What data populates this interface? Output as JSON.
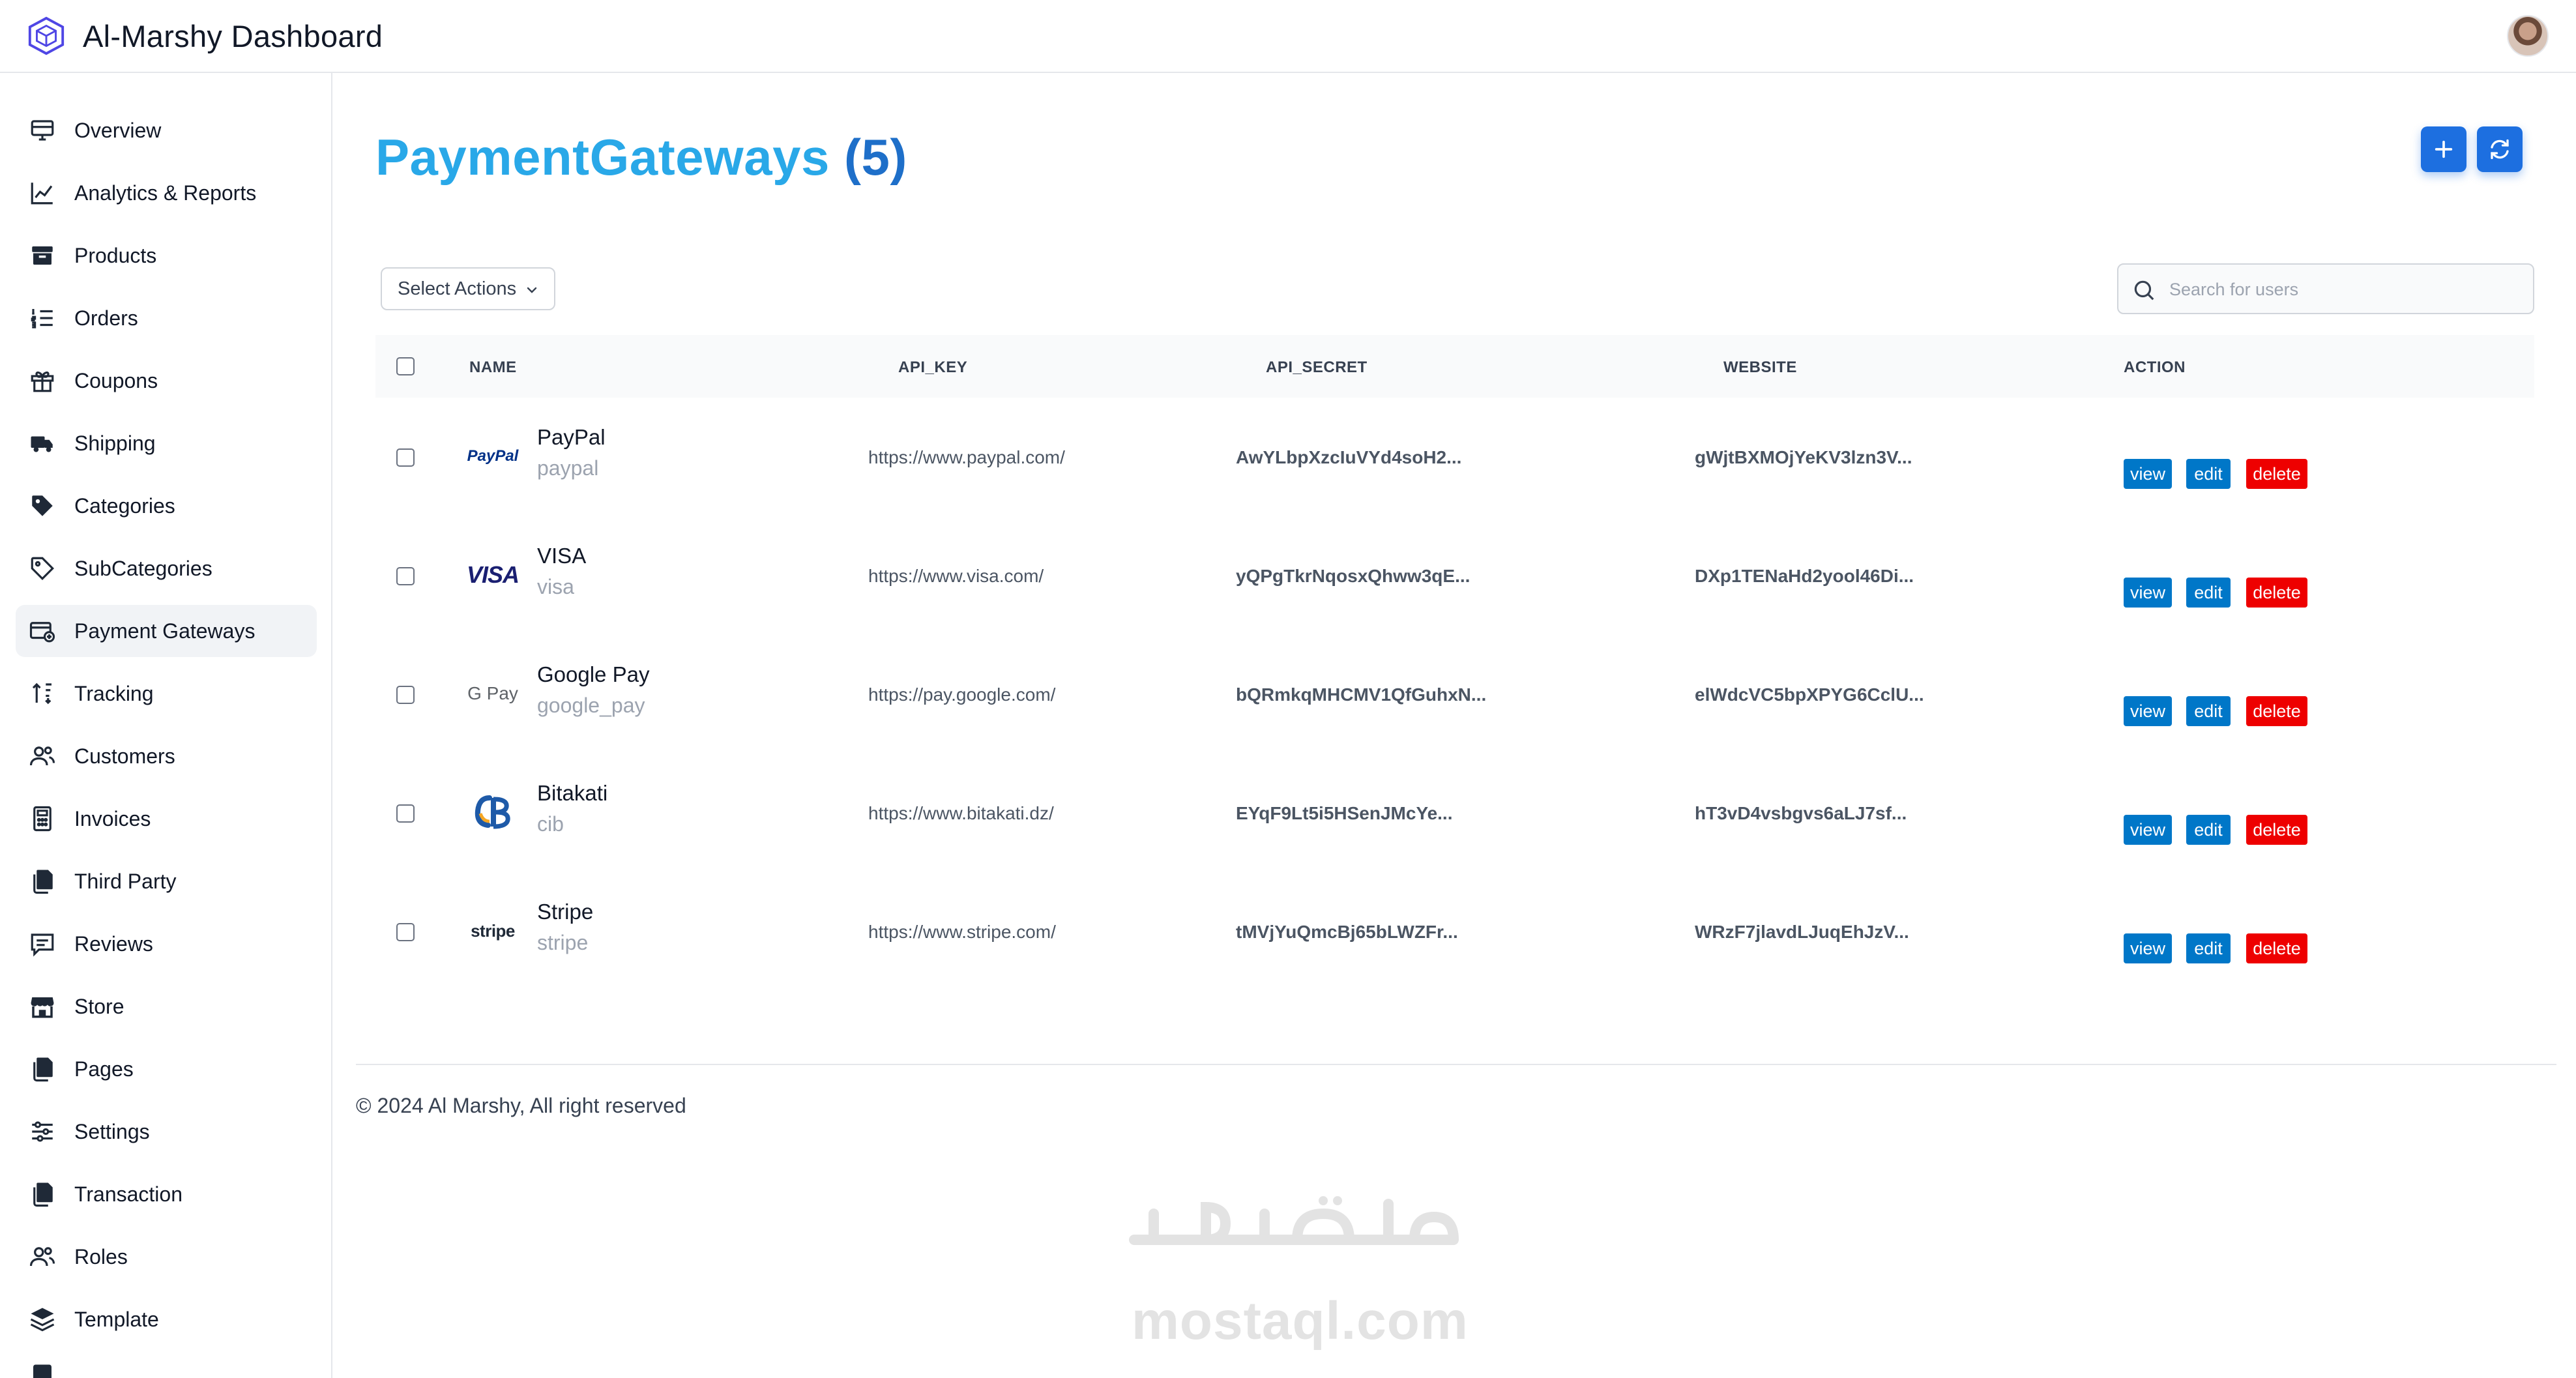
{
  "header": {
    "title": "Al-Marshy Dashboard",
    "logo_icon": "cube-icon",
    "avatar_icon": "user-avatar"
  },
  "sidebar": {
    "items": [
      {
        "label": "Overview",
        "icon": "monitor-icon"
      },
      {
        "label": "Analytics & Reports",
        "icon": "chart-line-icon"
      },
      {
        "label": "Products",
        "icon": "archive-box-icon"
      },
      {
        "label": "Orders",
        "icon": "list-ordered-icon"
      },
      {
        "label": "Coupons",
        "icon": "gift-icon"
      },
      {
        "label": "Shipping",
        "icon": "truck-icon"
      },
      {
        "label": "Categories",
        "icon": "tag-filled-icon"
      },
      {
        "label": "SubCategories",
        "icon": "tag-outline-icon"
      },
      {
        "label": "Payment Gateways",
        "icon": "payment-card-icon",
        "active": true
      },
      {
        "label": "Tracking",
        "icon": "sort-arrows-icon"
      },
      {
        "label": "Customers",
        "icon": "users-icon"
      },
      {
        "label": "Invoices",
        "icon": "calculator-icon"
      },
      {
        "label": "Third Party",
        "icon": "copy-icon"
      },
      {
        "label": "Reviews",
        "icon": "message-icon"
      },
      {
        "label": "Store",
        "icon": "store-icon"
      },
      {
        "label": "Pages",
        "icon": "pages-icon"
      },
      {
        "label": "Settings",
        "icon": "sliders-icon"
      },
      {
        "label": "Transaction",
        "icon": "transaction-icon"
      },
      {
        "label": "Roles",
        "icon": "roles-icon"
      },
      {
        "label": "Template",
        "icon": "layers-icon"
      }
    ]
  },
  "main": {
    "title": "PaymentGateways",
    "count": "(5)",
    "add_button_icon": "plus-icon",
    "refresh_button_icon": "refresh-icon",
    "select_actions_label": "Select Actions",
    "search_placeholder": "Search for users"
  },
  "table": {
    "columns": [
      "NAME",
      "API_KEY",
      "API_SECRET",
      "WEBSITE",
      "ACTION"
    ],
    "rows": [
      {
        "name": "PayPal",
        "code": "paypal",
        "api_key": "https://www.paypal.com/",
        "api_secret": "AwYLbpXzcIuVYd4soH2...",
        "website": "gWjtBXMOjYeKV3lzn3V...",
        "logo": "paypal-logo"
      },
      {
        "name": "VISA",
        "code": "visa",
        "api_key": "https://www.visa.com/",
        "api_secret": "yQPgTkrNqosxQhww3qE...",
        "website": "DXp1TENaHd2yool46Di...",
        "logo": "visa-logo"
      },
      {
        "name": "Google Pay",
        "code": "google_pay",
        "api_key": "https://pay.google.com/",
        "api_secret": "bQRmkqMHCMV1QfGuhxN...",
        "website": "elWdcVC5bpXPYG6CclU...",
        "logo": "google-pay-logo"
      },
      {
        "name": "Bitakati",
        "code": "cib",
        "api_key": "https://www.bitakati.dz/",
        "api_secret": "EYqF9Lt5i5HSenJMcYe...",
        "website": "hT3vD4vsbgvs6aLJ7sf...",
        "logo": "cib-logo"
      },
      {
        "name": "Stripe",
        "code": "stripe",
        "api_key": "https://www.stripe.com/",
        "api_secret": "tMVjYuQmcBj65bLWZFr...",
        "website": "WRzF7jlavdLJuqEhJzV...",
        "logo": "stripe-logo"
      }
    ],
    "actions": {
      "view": "view",
      "edit": "edit",
      "delete": "delete"
    }
  },
  "footer": {
    "text": "© 2024 Al Marshy, All right reserved"
  },
  "logos": {
    "paypal": "PayPal",
    "visa": "VISA",
    "gpay": "G Pay",
    "stripe": "stripe"
  },
  "watermark": {
    "latin": "mostaql.com",
    "arabic": "مستقل"
  },
  "colors": {
    "title": "#29a8e8",
    "title_count": "#1e6fc9",
    "primary_button": "#1d6fe0",
    "action_blue": "#0077c8",
    "action_red": "#ee0000",
    "active_nav_bg": "#f1f3f6"
  }
}
